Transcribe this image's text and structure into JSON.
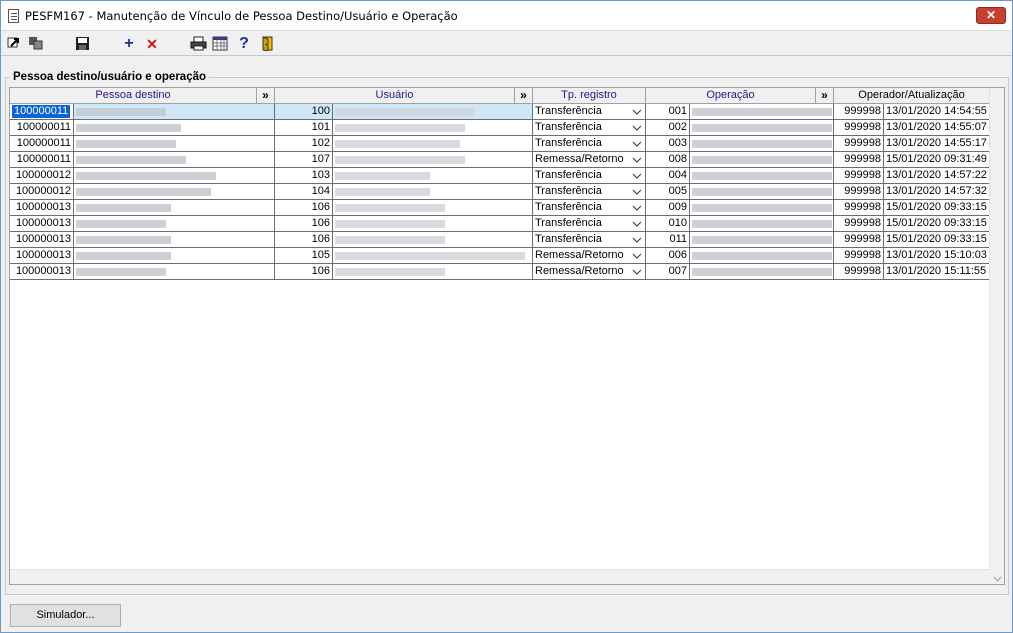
{
  "window": {
    "title": "PESFM167 - Manutenção de Vínculo de Pessoa Destino/Usuário e Operação",
    "close_glyph": "✕"
  },
  "toolbar": {
    "icons": [
      "export-icon",
      "copy-icon",
      "save-icon",
      "add-icon",
      "delete-icon",
      "print-icon",
      "calendar-icon",
      "help-icon",
      "exit-door-icon"
    ],
    "add_glyph": "+",
    "delete_glyph": "✕",
    "help_glyph": "?"
  },
  "group": {
    "label": "Pessoa destino/usuário e operação"
  },
  "grid": {
    "columns": {
      "pessoa_destino": "Pessoa destino",
      "usuario": "Usuário",
      "tp_registro": "Tp. registro",
      "operacao": "Operação",
      "operador_atualizacao": "Operador/Atualização",
      "expand": "»"
    },
    "rows": [
      {
        "pessoa": "100000011",
        "usuario": "100",
        "tp": "Transferência",
        "op": "001",
        "operador": "999998",
        "data": "13/01/2020 14:54:55"
      },
      {
        "pessoa": "100000011",
        "usuario": "101",
        "tp": "Transferência",
        "op": "002",
        "operador": "999998",
        "data": "13/01/2020 14:55:07"
      },
      {
        "pessoa": "100000011",
        "usuario": "102",
        "tp": "Transferência",
        "op": "003",
        "operador": "999998",
        "data": "13/01/2020 14:55:17"
      },
      {
        "pessoa": "100000011",
        "usuario": "107",
        "tp": "Remessa/Retorno",
        "op": "008",
        "operador": "999998",
        "data": "15/01/2020 09:31:49"
      },
      {
        "pessoa": "100000012",
        "usuario": "103",
        "tp": "Transferência",
        "op": "004",
        "operador": "999998",
        "data": "13/01/2020 14:57:22"
      },
      {
        "pessoa": "100000012",
        "usuario": "104",
        "tp": "Transferência",
        "op": "005",
        "operador": "999998",
        "data": "13/01/2020 14:57:32"
      },
      {
        "pessoa": "100000013",
        "usuario": "106",
        "tp": "Transferência",
        "op": "009",
        "operador": "999998",
        "data": "15/01/2020 09:33:15"
      },
      {
        "pessoa": "100000013",
        "usuario": "106",
        "tp": "Transferência",
        "op": "010",
        "operador": "999998",
        "data": "15/01/2020 09:33:15"
      },
      {
        "pessoa": "100000013",
        "usuario": "106",
        "tp": "Transferência",
        "op": "011",
        "operador": "999998",
        "data": "15/01/2020 09:33:15"
      },
      {
        "pessoa": "100000013",
        "usuario": "105",
        "tp": "Remessa/Retorno",
        "op": "006",
        "operador": "999998",
        "data": "13/01/2020 15:10:03"
      },
      {
        "pessoa": "100000013",
        "usuario": "106",
        "tp": "Remessa/Retorno",
        "op": "007",
        "operador": "999998",
        "data": "13/01/2020 15:11:55"
      }
    ]
  },
  "footer": {
    "simulator_label": "Simulador..."
  },
  "colors": {
    "header_text": "#1a1a8c",
    "selection": "#0a64d8",
    "close_button": "#c7402f"
  }
}
